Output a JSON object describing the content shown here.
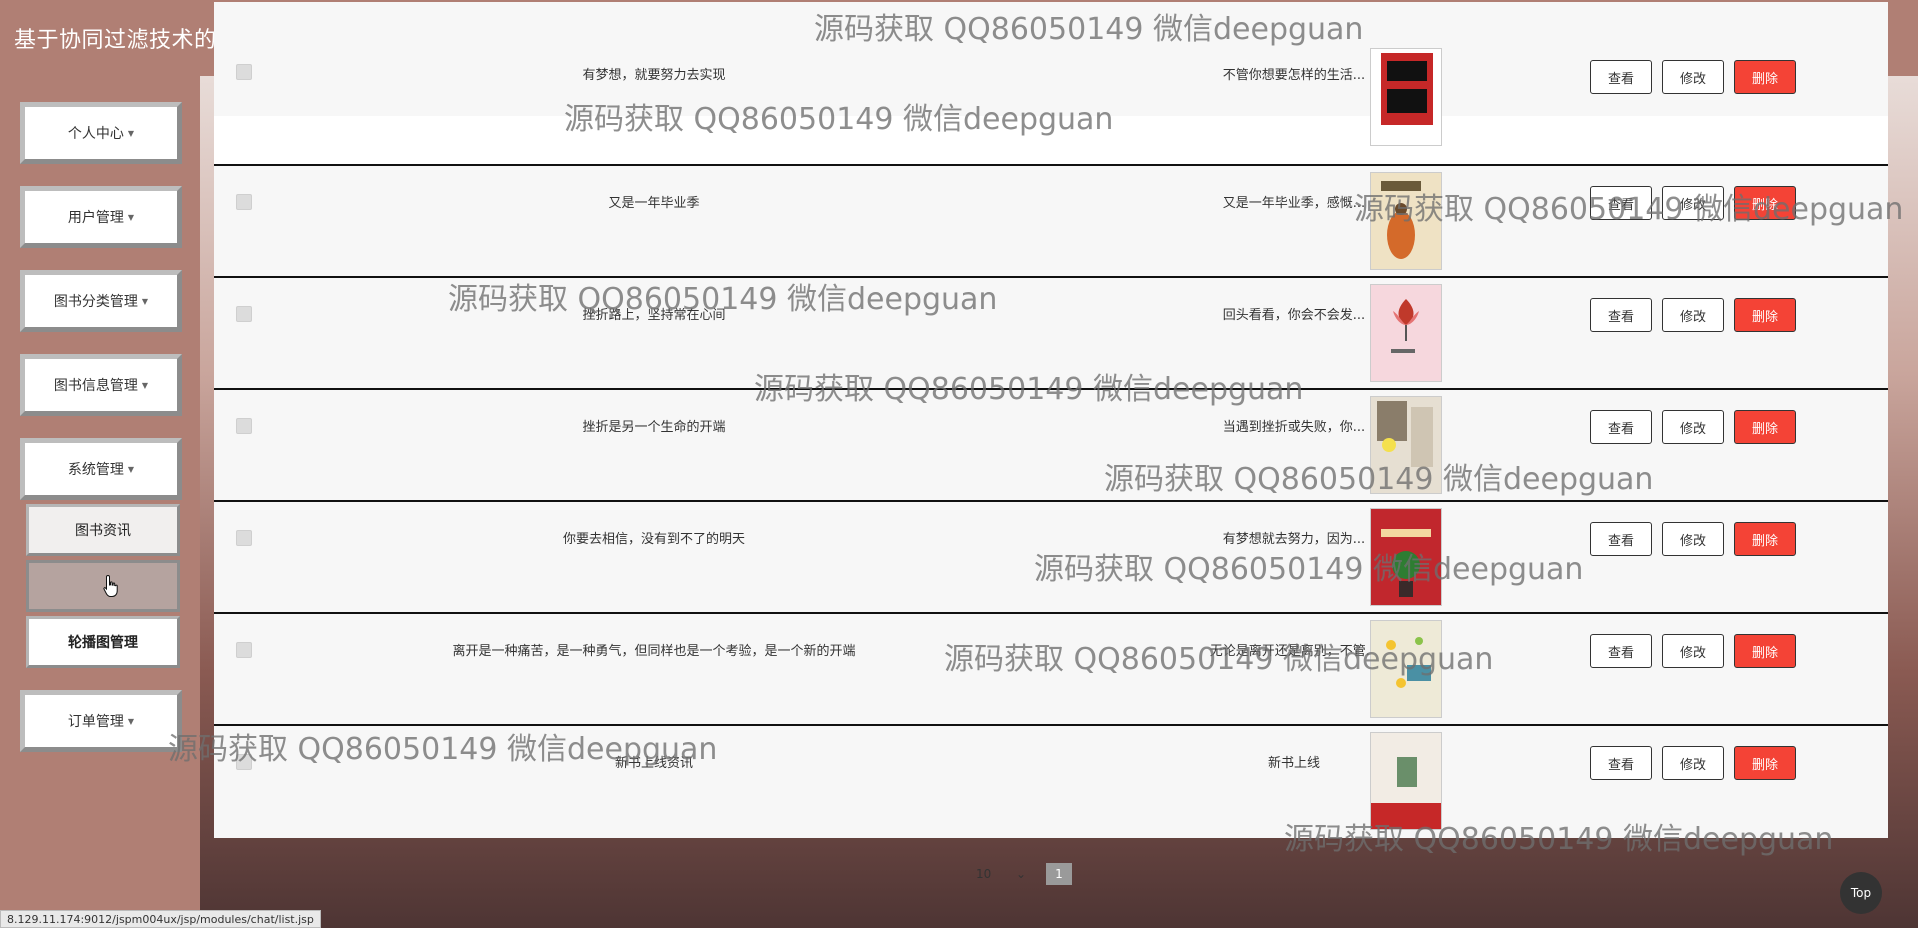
{
  "header": {
    "title": "基于协同过滤技术的网上书城",
    "fullscreen_icon": "expand-icon",
    "user_icon": "user-icon"
  },
  "sidebar": {
    "items": [
      {
        "label": "个人中心"
      },
      {
        "label": "用户管理"
      },
      {
        "label": "图书分类管理"
      },
      {
        "label": "图书信息管理"
      },
      {
        "label": "系统管理"
      }
    ],
    "sub_items": [
      {
        "label": "图书资讯"
      },
      {
        "label": ""
      },
      {
        "label": "轮播图管理"
      }
    ],
    "order": {
      "label": "订单管理"
    }
  },
  "table": {
    "rows": [
      {
        "title": "有梦想，就要努力去实现",
        "intro": "不管你想要怎样的生活...",
        "cover_color": "#c62828"
      },
      {
        "title": "又是一年毕业季",
        "intro": "又是一年毕业季，感慨...",
        "cover_color": "#d8b98a"
      },
      {
        "title": "挫折路上，坚持常在心间",
        "intro": "回头看看，你会不会发...",
        "cover_color": "#f1c6cf"
      },
      {
        "title": "挫折是另一个生命的开端",
        "intro": "当遇到挫折或失败，你...",
        "cover_color": "#8a7d6a"
      },
      {
        "title": "你要去相信，没有到不了的明天",
        "intro": "有梦想就去努力，因为...",
        "cover_color": "#c1272d"
      },
      {
        "title": "离开是一种痛苦，是一种勇气，但同样也是一个考验，是一个新的开端",
        "intro": "无论是离开还是离别，不管...",
        "cover_color": "#e8e4d0"
      },
      {
        "title": "新书上线资讯",
        "intro": "新书上线",
        "cover_color": "#f2ece4"
      }
    ],
    "actions": {
      "view": "查看",
      "edit": "修改",
      "delete": "删除"
    }
  },
  "pagination": {
    "page_size": "10",
    "current_page": "1"
  },
  "back_to_top": "Top",
  "status_url": "8.129.11.174:9012/jspm004ux/jsp/modules/chat/list.jsp",
  "watermark_text": "源码获取 QQ86050149 微信deepguan",
  "colors": {
    "header": "#b07f74",
    "delete_button": "#f44336"
  }
}
